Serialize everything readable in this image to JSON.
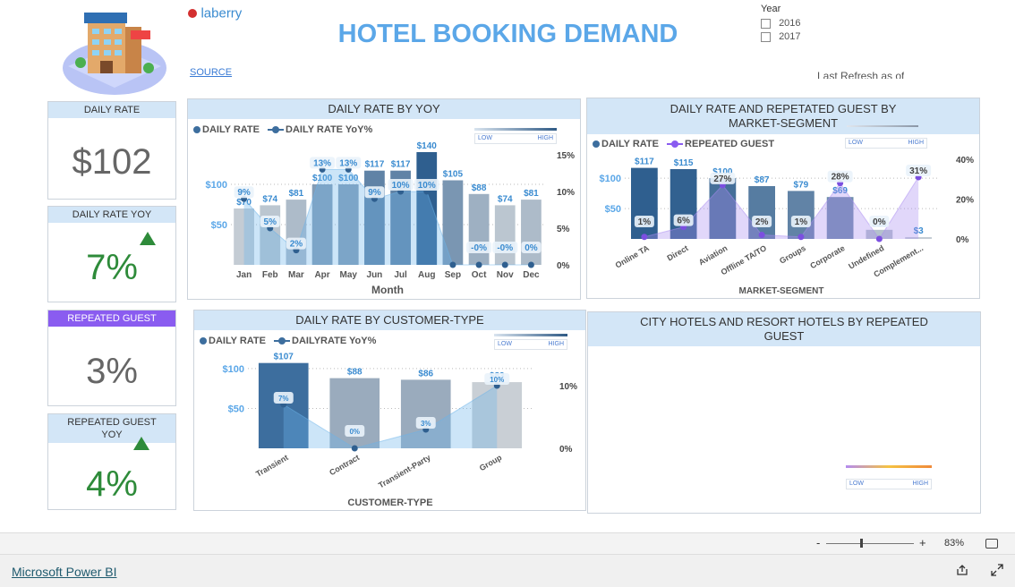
{
  "header": {
    "logo_text": "laberry",
    "title": "HOTEL BOOKING DEMAND",
    "source_link": "SOURCE",
    "refresh_text": "Last Refresh as of"
  },
  "year_filter": {
    "label": "Year",
    "options": [
      "2016",
      "2017"
    ]
  },
  "kpis": {
    "daily_rate": {
      "title": "DAILY RATE",
      "value": "$102"
    },
    "daily_rate_yoy": {
      "title": "DAILY RATE YOY",
      "value": "7%"
    },
    "repeated_guest": {
      "title": "REPEATED GUEST",
      "value": "3%"
    },
    "repeated_guest_yoy": {
      "title": "REPEATED GUEST YOY",
      "value": "4%"
    }
  },
  "colors": {
    "accent_blue": "#5ba7e8",
    "kpi_green": "#2e8b3a",
    "purple": "#8a5cf0",
    "header_bg": "#d3e6f7"
  },
  "gradient_legend": {
    "low": "LOW",
    "high": "HIGH"
  },
  "chart_data": [
    {
      "type": "bar",
      "title": "DAILY RATE BY YOY",
      "xlabel": "Month",
      "legend": [
        "DAILY RATE",
        "DAILY RATE YoY%"
      ],
      "categories": [
        "Jan",
        "Feb",
        "Mar",
        "Apr",
        "May",
        "Jun",
        "Jul",
        "Aug",
        "Sep",
        "Oct",
        "Nov",
        "Dec"
      ],
      "series": [
        {
          "name": "DAILY RATE",
          "values": [
            70,
            74,
            81,
            100,
            100,
            117,
            117,
            140,
            105,
            88,
            74,
            81
          ],
          "labels": [
            "$70",
            "$74",
            "$81",
            "$100",
            "$100",
            "$117",
            "$117",
            "$140",
            "$105",
            "$88",
            "$74",
            "$81"
          ]
        },
        {
          "name": "DAILY RATE YoY%",
          "values": [
            9,
            5,
            2,
            13,
            13,
            9,
            10,
            10,
            0,
            0,
            0,
            0
          ],
          "labels": [
            "9%",
            "5%",
            "2%",
            "13%",
            "13%",
            "9%",
            "10%",
            "10%",
            "",
            "-0%",
            "-0%",
            "0%"
          ]
        }
      ],
      "y_ticks": [
        "$100",
        "$50"
      ],
      "y2_ticks": [
        "15%",
        "10%",
        "5%",
        "0%"
      ],
      "ylim": [
        0,
        150
      ]
    },
    {
      "type": "bar",
      "title": "DAILY RATE AND REPETATED GUEST BY MARKET-SEGMENT",
      "xlabel": "MARKET-SEGMENT",
      "legend": [
        "DAILY RATE",
        "REPEATED GUEST"
      ],
      "categories": [
        "Online TA",
        "Direct",
        "Aviation",
        "Offline TA/TO",
        "Groups",
        "Corporate",
        "Undefined",
        "Complement..."
      ],
      "series": [
        {
          "name": "DAILY RATE",
          "values": [
            117,
            115,
            100,
            87,
            79,
            69,
            15,
            3
          ],
          "labels": [
            "$117",
            "$115",
            "$100",
            "$87",
            "$79",
            "$69",
            "$15",
            "$3"
          ]
        },
        {
          "name": "REPEATED GUEST",
          "values": [
            1,
            6,
            27,
            2,
            1,
            28,
            0,
            31
          ],
          "labels": [
            "1%",
            "6%",
            "27%",
            "2%",
            "1%",
            "28%",
            "0%",
            "31%"
          ]
        }
      ],
      "y_ticks": [
        "$100",
        "$50"
      ],
      "y2_ticks": [
        "40%",
        "20%",
        "0%"
      ],
      "ylim": [
        0,
        140
      ]
    },
    {
      "type": "bar",
      "title": "DAILY RATE BY CUSTOMER-TYPE",
      "xlabel": "CUSTOMER-TYPE",
      "legend": [
        "DAILY RATE",
        "DAILYRATE  YoY%"
      ],
      "categories": [
        "Transient",
        "Contract",
        "Transient-Party",
        "Group"
      ],
      "series": [
        {
          "name": "DAILY RATE",
          "values": [
            107,
            88,
            86,
            83
          ],
          "labels": [
            "$107",
            "$88",
            "$86",
            "$83"
          ]
        },
        {
          "name": "DAILYRATE  YoY%",
          "values": [
            7,
            0,
            3,
            10
          ],
          "labels": [
            "7%",
            "0%",
            "3%",
            "10%"
          ]
        }
      ],
      "y_ticks": [
        "$100",
        "$50"
      ],
      "y2_ticks": [
        "10%",
        "0%"
      ],
      "ylim": [
        0,
        110
      ]
    }
  ],
  "empty_panel": {
    "title": "CITY HOTELS AND RESORT HOTELS BY REPEATED GUEST"
  },
  "zoom": {
    "minus": "-",
    "plus": "+",
    "level": "83%"
  },
  "footer": {
    "brand": "Microsoft Power BI"
  }
}
